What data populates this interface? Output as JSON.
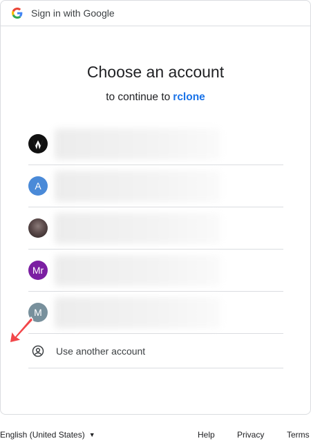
{
  "header": {
    "title": "Sign in with Google"
  },
  "main": {
    "title": "Choose an account",
    "subtitle_prefix": "to continue to",
    "app_name": "rclone"
  },
  "accounts": [
    {
      "avatar_text": "",
      "avatar_style": "dark-logo",
      "avatar_color": "#111111"
    },
    {
      "avatar_text": "A",
      "avatar_color": "#4285f4"
    },
    {
      "avatar_text": "",
      "avatar_style": "photo",
      "avatar_color": "#5b4a4a"
    },
    {
      "avatar_text": "Mr",
      "avatar_color": "#7b1fa2"
    },
    {
      "avatar_text": "M",
      "avatar_color": "#78909c"
    }
  ],
  "use_another": {
    "label": "Use another account",
    "icon": "person-circle-icon"
  },
  "footer": {
    "language": "English (United States)",
    "help": "Help",
    "privacy": "Privacy",
    "terms": "Terms"
  },
  "colors": {
    "accent": "#1a73e8",
    "divider": "#dadce0",
    "pointer_arrow": "#f2474a"
  }
}
